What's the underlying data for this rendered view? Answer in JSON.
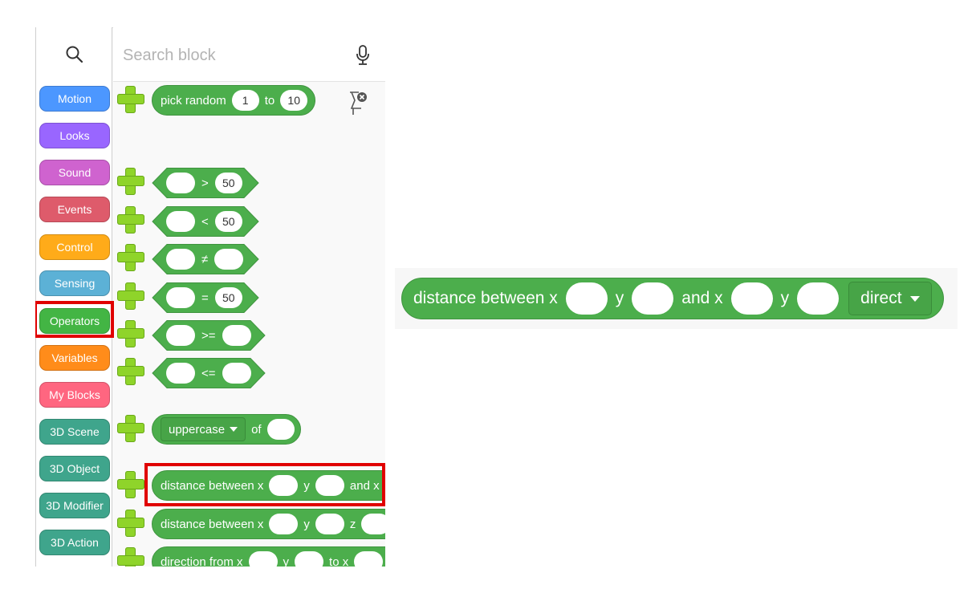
{
  "search": {
    "placeholder": "Search block"
  },
  "categories": [
    {
      "label": "Motion",
      "color": "#4c97ff"
    },
    {
      "label": "Looks",
      "color": "#9966ff"
    },
    {
      "label": "Sound",
      "color": "#cf63cf"
    },
    {
      "label": "Events",
      "color": "#de5b6b"
    },
    {
      "label": "Control",
      "color": "#ffab19"
    },
    {
      "label": "Sensing",
      "color": "#5cb1d6"
    },
    {
      "label": "Operators",
      "color": "#43b544"
    },
    {
      "label": "Variables",
      "color": "#ff8c1a"
    },
    {
      "label": "My Blocks",
      "color": "#ff6680"
    },
    {
      "label": "3D Scene",
      "color": "#3fa58c"
    },
    {
      "label": "3D Object",
      "color": "#3fa58c"
    },
    {
      "label": "3D Modifier",
      "color": "#3fa58c"
    },
    {
      "label": "3D Action",
      "color": "#3fa58c"
    }
  ],
  "blocks": {
    "pick_random": {
      "label": "pick random",
      "from": "1",
      "to_label": "to",
      "to": "10"
    },
    "greater": {
      "op": ">",
      "right": "50"
    },
    "less": {
      "op": "<",
      "right": "50"
    },
    "not_equal": {
      "op": "≠"
    },
    "equal": {
      "op": "=",
      "right": "50"
    },
    "gte": {
      "op": ">="
    },
    "lte": {
      "op": "<="
    },
    "uppercase": {
      "dropdown": "uppercase",
      "of": "of"
    },
    "distance2d": {
      "label": "distance between x",
      "y": "y",
      "and": "and x"
    },
    "distance3d": {
      "label": "distance between x",
      "y": "y",
      "z": "z"
    },
    "direction": {
      "label": "direction from x",
      "y": "y",
      "to": "to x"
    }
  },
  "enlarged_block": {
    "label": "distance between x",
    "y1": "y",
    "and": "and x",
    "y2": "y",
    "dropdown": "direct"
  }
}
